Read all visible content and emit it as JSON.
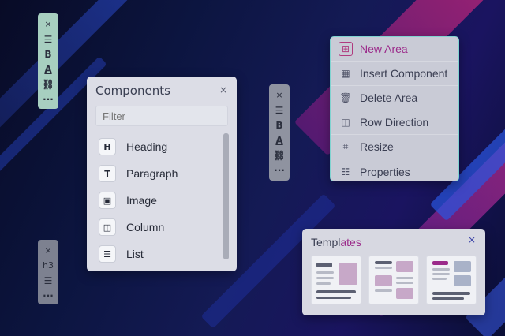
{
  "colors": {
    "accent": "#9b2a8a",
    "menu_icon": "#b03a7f",
    "panel_bg": "#dcdde6",
    "toolbar_green": "#a7cfc0",
    "toolbar_gray": "#8f93a0"
  },
  "toolbar_a": {
    "close": "×",
    "items": [
      {
        "icon": "list-icon",
        "glyph": "☰"
      },
      {
        "icon": "bold-icon",
        "glyph": "B"
      },
      {
        "icon": "text-color-icon",
        "glyph": "A"
      },
      {
        "icon": "link-icon",
        "glyph": "⛓"
      },
      {
        "icon": "more-icon",
        "glyph": "···"
      }
    ]
  },
  "toolbar_b": {
    "close": "×",
    "items": [
      {
        "icon": "align-left-icon",
        "glyph": "☰"
      },
      {
        "icon": "bold-icon",
        "glyph": "B"
      },
      {
        "icon": "text-color-icon",
        "glyph": "A"
      },
      {
        "icon": "link-icon",
        "glyph": "⛓"
      },
      {
        "icon": "more-icon",
        "glyph": "···"
      }
    ]
  },
  "toolbar_c": {
    "close": "×",
    "items": [
      {
        "icon": "heading-level-label",
        "glyph": "h3"
      },
      {
        "icon": "align-left-icon",
        "glyph": "☰"
      },
      {
        "icon": "more-icon",
        "glyph": "···"
      }
    ]
  },
  "components": {
    "title": "Components",
    "close": "×",
    "filter_placeholder": "Filter",
    "items": [
      {
        "label": "Heading",
        "icon": "heading-icon",
        "glyph": "H"
      },
      {
        "label": "Paragraph",
        "icon": "paragraph-icon",
        "glyph": "T"
      },
      {
        "label": "Image",
        "icon": "image-icon",
        "glyph": "▣"
      },
      {
        "label": "Column",
        "icon": "column-icon",
        "glyph": "◫"
      },
      {
        "label": "List",
        "icon": "list-icon",
        "glyph": "☰"
      }
    ]
  },
  "context_menu": {
    "items": [
      {
        "label": "New Area",
        "icon": "new-area-icon",
        "glyph": "⊞"
      },
      {
        "label": "Insert Component",
        "icon": "insert-component-icon",
        "glyph": "▦"
      },
      {
        "label": "Delete Area",
        "icon": "trash-icon",
        "glyph": "🗑"
      },
      {
        "label": "Row Direction",
        "icon": "row-direction-icon",
        "glyph": "◫"
      },
      {
        "label": "Resize",
        "icon": "crop-icon",
        "glyph": "⌗"
      },
      {
        "label": "Properties",
        "icon": "sliders-icon",
        "glyph": "☷"
      }
    ]
  },
  "templates": {
    "title_start": "Templ",
    "title_end": "ates",
    "close": "×"
  }
}
